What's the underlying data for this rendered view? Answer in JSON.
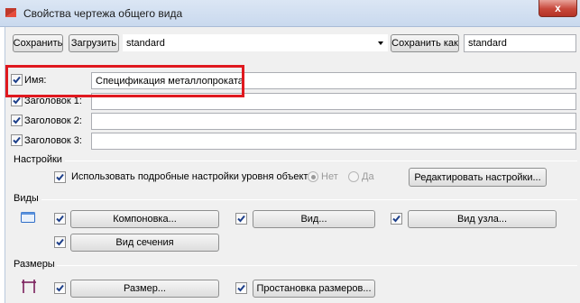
{
  "window": {
    "title": "Свойства чертежа общего вида",
    "close_glyph": "x"
  },
  "toolbar": {
    "save_label": "Сохранить",
    "load_label": "Загрузить",
    "preset_value": "standard",
    "save_as_label": "Сохранить как",
    "save_as_value": "standard"
  },
  "fields": [
    {
      "label": "Имя:",
      "value": "Спецификация металлопроката",
      "checked": true
    },
    {
      "label": "Заголовок 1:",
      "value": "",
      "checked": true
    },
    {
      "label": "Заголовок 2:",
      "value": "",
      "checked": true
    },
    {
      "label": "Заголовок 3:",
      "value": "",
      "checked": true
    }
  ],
  "settings": {
    "section_label": "Настройки",
    "use_detailed_label": "Использовать подробные настройки уровня объекта",
    "radio_no": "Нет",
    "radio_yes": "Да",
    "edit_settings_label": "Редактировать настройки..."
  },
  "views": {
    "section_label": "Виды",
    "layout_label": "Компоновка...",
    "view_label": "Вид...",
    "node_view_label": "Вид узла...",
    "section_view_label": "Вид сечения"
  },
  "dimensions": {
    "section_label": "Размеры",
    "dimension_label": "Размер...",
    "placement_label": "Простановка размеров..."
  },
  "colors": {
    "highlight": "#e0191f",
    "close_button": "#c7473a"
  }
}
